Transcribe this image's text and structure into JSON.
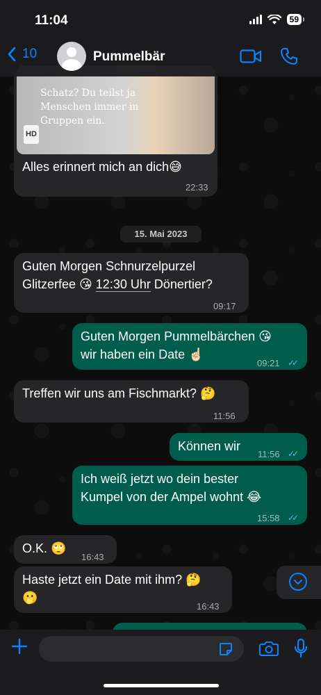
{
  "status": {
    "time": "11:04",
    "battery": "59"
  },
  "nav": {
    "back_count": "10",
    "contact_name": "Pummelbär"
  },
  "media": {
    "caption": "Schatz? Du teilst ja Menschen immer in Gruppen ein.",
    "badge": "HD",
    "text": "Alles erinnert mich an dich😅",
    "time": "22:33"
  },
  "date_divider": "15. Mai 2023",
  "messages": [
    {
      "text": "Guten Morgen Schnurzelpurzel",
      "text2_a": "Glitzerfee 😘 ",
      "text2_link": "12:30 Uhr",
      "text2_b": " Dönertier?",
      "time": "09:17"
    },
    {
      "text": "Guten Morgen Pummelbärchen 😘",
      "text2": "wir haben ein Date ☝🏻",
      "time": "09:21"
    },
    {
      "text": "Treffen wir uns am Fischmarkt? 🤔",
      "time": "11:56"
    },
    {
      "text": "Können wir",
      "time": "11:56"
    },
    {
      "text": "Ich weiß jetzt wo dein bester",
      "text2": "Kumpel von der Ampel wohnt 😂",
      "time": "15:58"
    },
    {
      "text": "O.K. 🙄",
      "time": "16:43"
    },
    {
      "text": "Haste jetzt ein Date mit ihm? 🤔",
      "text2": "🫢",
      "time": "16:43"
    }
  ],
  "colors": {
    "accent": "#0a84ff",
    "incoming": "#262628",
    "outgoing": "#005c4b",
    "read_ticks": "#53bdeb"
  },
  "icons": [
    "back-chevron-icon",
    "video-call-icon",
    "phone-icon",
    "plus-icon",
    "sticker-icon",
    "camera-icon",
    "microphone-icon",
    "scroll-down-icon"
  ]
}
